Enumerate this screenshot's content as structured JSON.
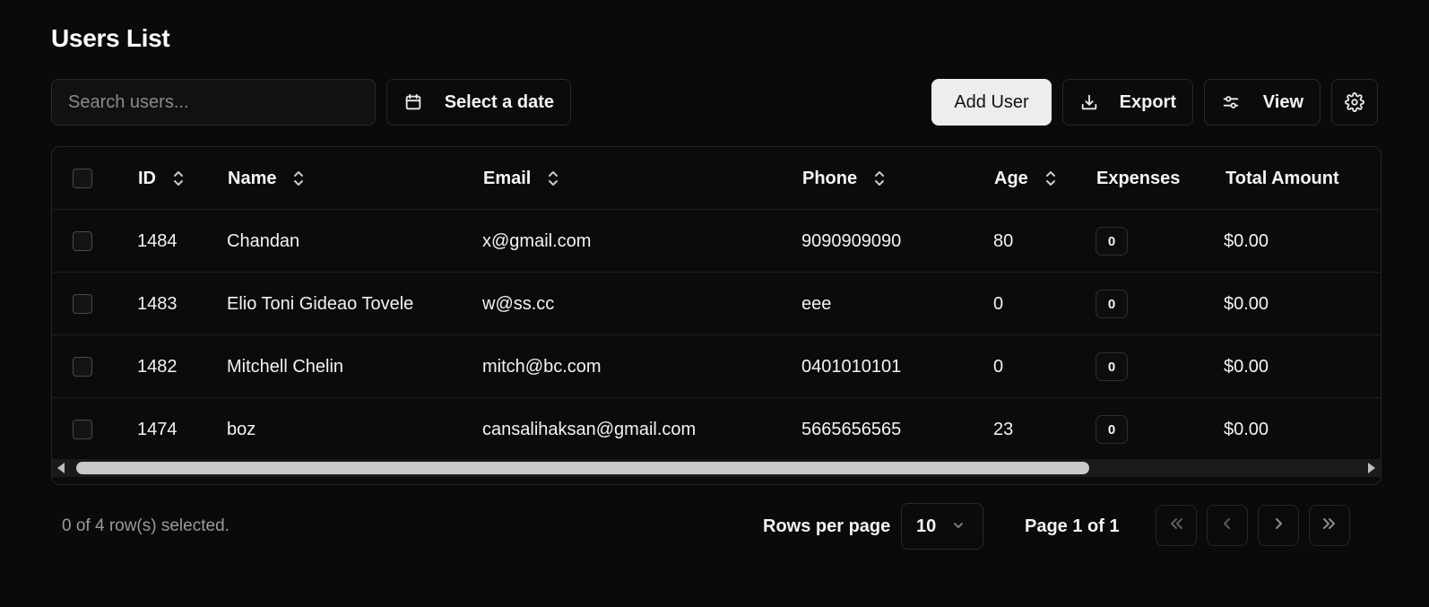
{
  "page": {
    "title": "Users List"
  },
  "toolbar": {
    "search_placeholder": "Search users...",
    "date_label": "Select a date",
    "add_user_label": "Add User",
    "export_label": "Export",
    "view_label": "View"
  },
  "table": {
    "columns": [
      "ID",
      "Name",
      "Email",
      "Phone",
      "Age",
      "Expenses",
      "Total Amount"
    ],
    "rows": [
      {
        "id": "1484",
        "name": "Chandan",
        "email": "x@gmail.com",
        "phone": "9090909090",
        "age": "80",
        "expenses": "0",
        "total": "$0.00"
      },
      {
        "id": "1483",
        "name": "Elio Toni Gideao Tovele",
        "email": "w@ss.cc",
        "phone": "eee",
        "age": "0",
        "expenses": "0",
        "total": "$0.00"
      },
      {
        "id": "1482",
        "name": "Mitchell Chelin",
        "email": "mitch@bc.com",
        "phone": "0401010101",
        "age": "0",
        "expenses": "0",
        "total": "$0.00"
      },
      {
        "id": "1474",
        "name": "boz",
        "email": "cansalihaksan@gmail.com",
        "phone": "5665656565",
        "age": "23",
        "expenses": "0",
        "total": "$0.00"
      }
    ]
  },
  "footer": {
    "selection_text": "0 of 4 row(s) selected.",
    "rows_per_page_label": "Rows per page",
    "rows_per_page_value": "10",
    "page_text": "Page 1 of 1"
  },
  "icons": {
    "date": "calendar-icon",
    "export": "download-icon",
    "view": "sliders-icon",
    "settings": "gear-icon",
    "sort": "sort-icon"
  },
  "colors": {
    "background": "#0a0a0a",
    "primary_button": "#ededed",
    "border": "#2a2a2a",
    "muted_text": "#9a9a9a"
  }
}
